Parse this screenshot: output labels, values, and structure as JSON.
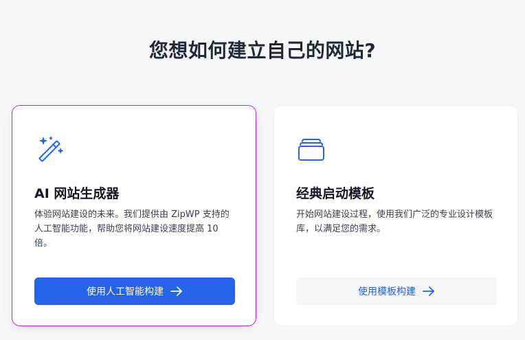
{
  "page": {
    "title": "您想如何建立自己的网站?"
  },
  "cards": [
    {
      "icon": "magic-wand-icon",
      "title": "AI 网站生成器",
      "description": "体验网站建设的未来。我们提供由 ZipWP 支持的人工智能功能，帮助您将网站建设速度提高 10 倍。",
      "button_label": "使用人工智能构建",
      "selected": true
    },
    {
      "icon": "template-stack-icon",
      "title": "经典启动模板",
      "description": "开始网站建设过程，使用我们广泛的专业设计模板库，以满足您的需求。",
      "button_label": "使用模板构建",
      "selected": false
    }
  ],
  "colors": {
    "accent": "#2563eb",
    "selected_border": "#c026d3",
    "background": "#f6f7f9"
  }
}
